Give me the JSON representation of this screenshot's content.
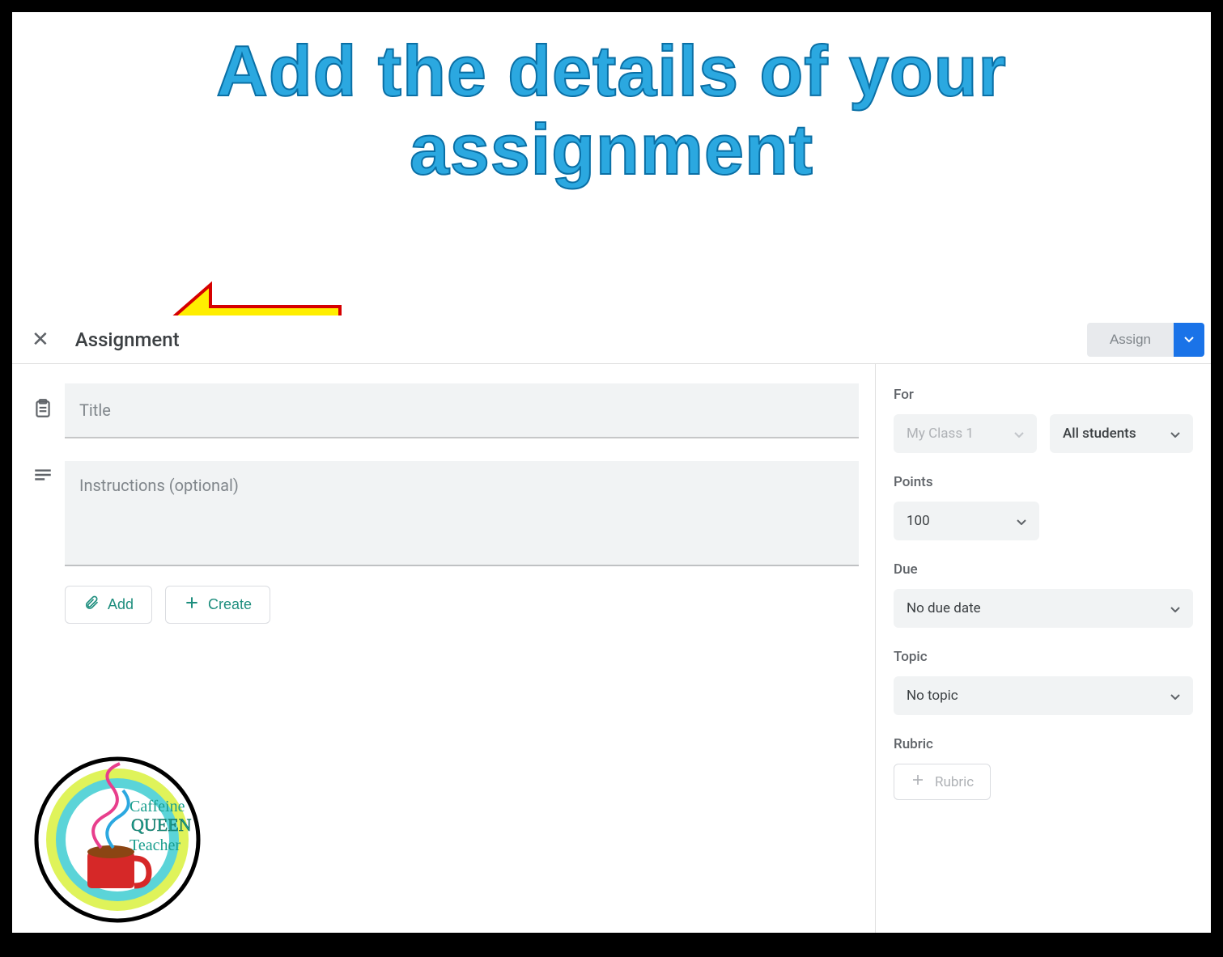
{
  "tutorial": {
    "heading": "Add the details of your assignment",
    "logo_text1": "Caffeine",
    "logo_text2": "QUEEN",
    "logo_text3": "Teacher"
  },
  "header": {
    "title": "Assignment",
    "assign_label": "Assign"
  },
  "main": {
    "title_placeholder": "Title",
    "instructions_placeholder": "Instructions (optional)",
    "add_label": "Add",
    "create_label": "Create"
  },
  "sidebar": {
    "for_label": "For",
    "class_value": "My Class 1",
    "students_value": "All students",
    "points_label": "Points",
    "points_value": "100",
    "due_label": "Due",
    "due_value": "No due date",
    "topic_label": "Topic",
    "topic_value": "No topic",
    "rubric_label": "Rubric",
    "rubric_button": "Rubric"
  }
}
